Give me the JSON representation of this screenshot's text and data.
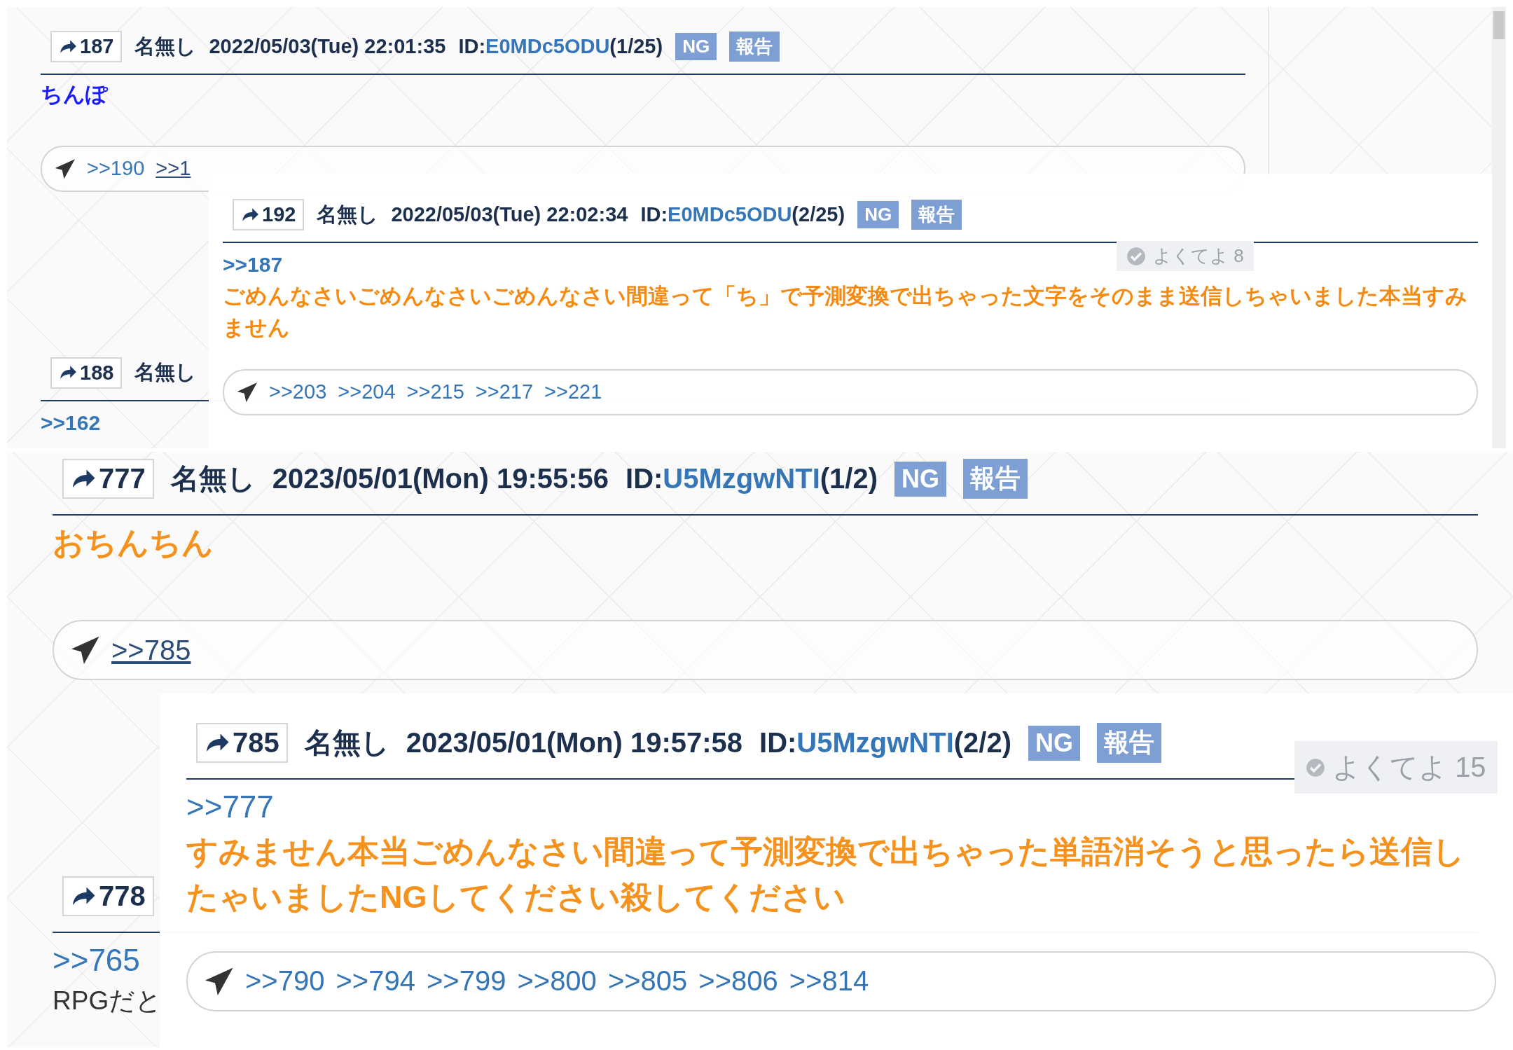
{
  "panels": [
    {
      "posts": [
        {
          "number": "187",
          "name": "名無し",
          "date": "2022/05/03(Tue) 22:01:35",
          "id_label": "ID:",
          "id": "E0MDc5ODU",
          "id_count": "(1/25)",
          "buttons": [
            "NG",
            "報告"
          ],
          "body": "ちんぽ",
          "color": "#1a1aff",
          "replies": [
            {
              "label": ">>190",
              "hovered": false
            },
            {
              "label": ">>1",
              "hovered": true
            }
          ]
        },
        {
          "number": "188",
          "name": "名無し",
          "reply_to": ">>162"
        }
      ],
      "popup": {
        "number": "192",
        "name": "名無し",
        "date": "2022/05/03(Tue) 22:02:34",
        "id_label": "ID:",
        "id": "E0MDc5ODU",
        "id_count": "(2/25)",
        "buttons": [
          "NG",
          "報告"
        ],
        "like": {
          "label": "よくてよ",
          "count": "8"
        },
        "reply_to": ">>187",
        "body": "ごめんなさいごめんなさいごめんなさい間違って「ち」で予測変換で出ちゃった文字をそのまま送信しちゃいました本当すみません",
        "color": "#f58a12",
        "replies": [
          {
            "label": ">>203",
            "hovered": false
          },
          {
            "label": ">>204",
            "hovered": false
          },
          {
            "label": ">>215",
            "hovered": false
          },
          {
            "label": ">>217",
            "hovered": false
          },
          {
            "label": ">>221",
            "hovered": false
          }
        ]
      }
    },
    {
      "posts": [
        {
          "number": "777",
          "name": "名無し",
          "date": "2023/05/01(Mon) 19:55:56",
          "id_label": "ID:",
          "id": "U5MzgwNTI",
          "id_count": "(1/2)",
          "buttons": [
            "NG",
            "報告"
          ],
          "body": "おちんちん",
          "color": "#f5921e",
          "replies": [
            {
              "label": ">>785",
              "hovered": true
            }
          ]
        },
        {
          "number": "778",
          "reply_to": ">>765",
          "body": "RPGだと",
          "color": "#333333"
        }
      ],
      "popup": {
        "number": "785",
        "name": "名無し",
        "date": "2023/05/01(Mon) 19:57:58",
        "id_label": "ID:",
        "id": "U5MzgwNTI",
        "id_count": "(2/2)",
        "buttons": [
          "NG",
          "報告"
        ],
        "like": {
          "label": "よくてよ",
          "count": "15"
        },
        "reply_to": ">>777",
        "body": "すみません本当ごめんなさい間違って予測変換で出ちゃった単語消そうと思ったら送信したゃいましたNGしてください殺してください",
        "color": "#f5921e",
        "replies": [
          {
            "label": ">>790",
            "hovered": false
          },
          {
            "label": ">>794",
            "hovered": false
          },
          {
            "label": ">>799",
            "hovered": false
          },
          {
            "label": ">>800",
            "hovered": false
          },
          {
            "label": ">>805",
            "hovered": false
          },
          {
            "label": ">>806",
            "hovered": false
          },
          {
            "label": ">>814",
            "hovered": false
          }
        ]
      }
    }
  ]
}
